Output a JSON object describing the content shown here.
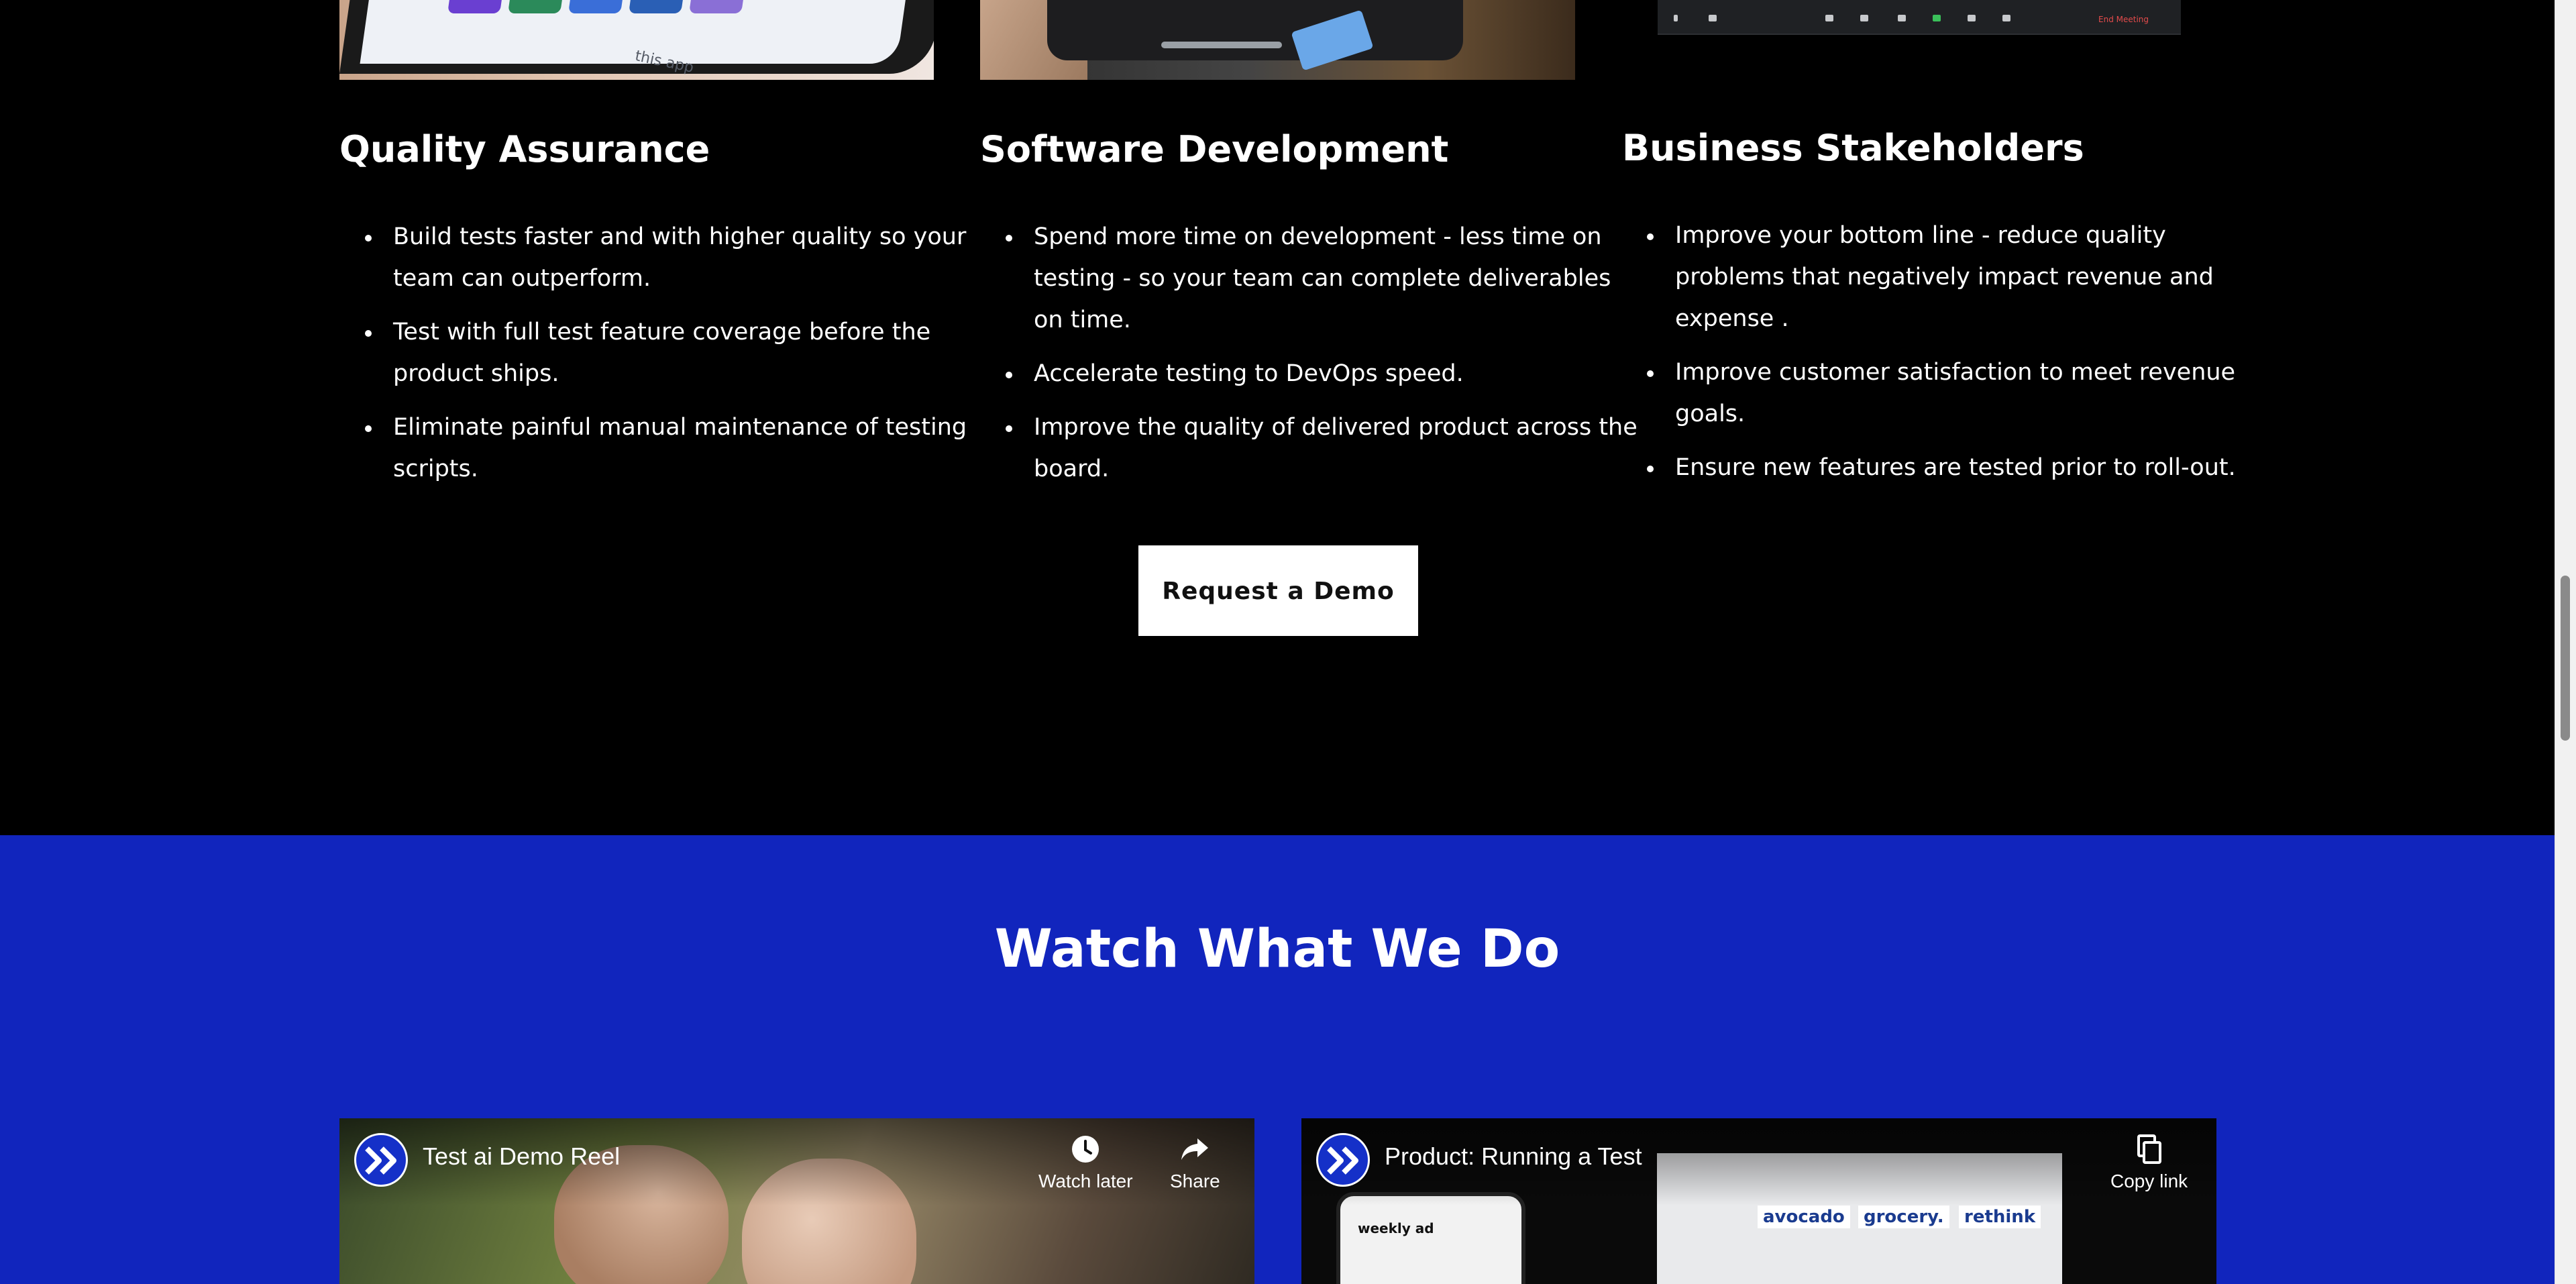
{
  "benefits": {
    "quality_assurance": {
      "heading": "Quality Assurance",
      "items": [
        "Build tests faster and with higher quality so your team can outperform.",
        "Test with full test feature coverage before the product ships.",
        "Eliminate painful manual maintenance of testing scripts."
      ],
      "image_caption": "this app"
    },
    "software_development": {
      "heading": "Software Development",
      "items": [
        "Spend more time on development - less time on testing - so your team can complete deliverables on time.",
        "Accelerate testing to DevOps speed.",
        "Improve the quality of delivered product across the board."
      ]
    },
    "business_stakeholders": {
      "heading": "Business Stakeholders",
      "items": [
        "Improve your bottom line - reduce quality problems that negatively impact revenue and expense .",
        "Improve customer satisfaction to meet revenue goals.",
        "Ensure new features are tested prior to roll-out."
      ],
      "image_toolbar_label": "End Meeting"
    },
    "demo_button_label": "Request a Demo"
  },
  "videos_section": {
    "title": "Watch What We Do",
    "video_1": {
      "title": "Test ai Demo Reel",
      "watch_later_label": "Watch later",
      "share_label": "Share"
    },
    "video_2": {
      "title": "Product: Running a Test",
      "copy_link_label": "Copy link",
      "phone_screen_title": "weekly ad",
      "tile_labels": [
        "avocado",
        "grocery.",
        "rethink"
      ]
    }
  },
  "colors": {
    "dark_section_bg": "#000000",
    "video_section_bg": "#1125bd",
    "button_bg": "#ffffff",
    "text": "#ffffff"
  },
  "icons": {
    "channel_logo": "double-chevron-right-icon",
    "watch_later": "clock-icon",
    "share": "share-arrow-icon",
    "copy_link": "copy-icon"
  }
}
